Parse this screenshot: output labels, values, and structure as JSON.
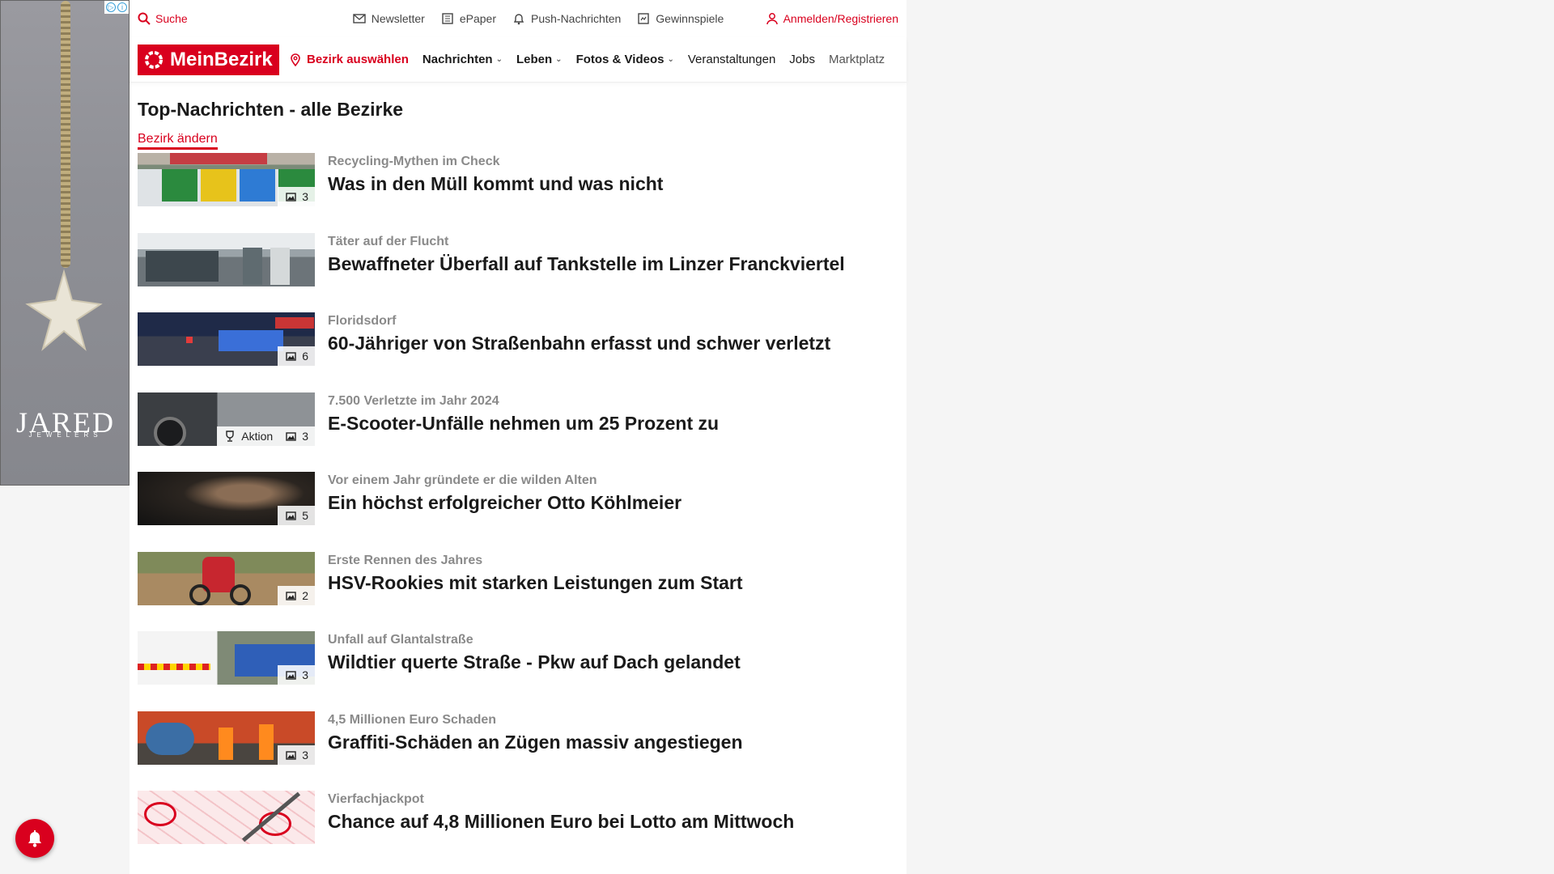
{
  "ad": {
    "brand": "JARED",
    "brand_sub": "JEWELERS"
  },
  "utility": {
    "search_label": "Suche",
    "links": [
      {
        "label": "Newsletter",
        "icon": "mail-icon"
      },
      {
        "label": "ePaper",
        "icon": "newspaper-icon"
      },
      {
        "label": "Push-Nachrichten",
        "icon": "bell-icon"
      },
      {
        "label": "Gewinnspiele",
        "icon": "gift-icon"
      }
    ],
    "login_label": "Anmelden/Registrieren"
  },
  "nav": {
    "logo_text": "MeinBezirk",
    "district_label": "Bezirk auswählen",
    "items": [
      {
        "label": "Nachrichten",
        "has_dropdown": true
      },
      {
        "label": "Leben",
        "has_dropdown": true
      },
      {
        "label": "Fotos & Videos",
        "has_dropdown": true
      },
      {
        "label": "Veranstaltungen",
        "has_dropdown": false
      },
      {
        "label": "Jobs",
        "has_dropdown": false
      },
      {
        "label": "Marktplatz",
        "has_dropdown": false
      }
    ]
  },
  "section": {
    "title": "Top-Nachrichten - alle Bezirke",
    "change_label": "Bezirk ändern"
  },
  "articles": [
    {
      "kicker": "Recycling-Mythen im Check",
      "headline": "Was in den Müll kommt und was nicht",
      "photos": "3",
      "badge": ""
    },
    {
      "kicker": "Täter auf der Flucht",
      "headline": "Bewaffneter Überfall auf Tankstelle im Linzer Franckviertel",
      "photos": "",
      "badge": ""
    },
    {
      "kicker": "Floridsdorf",
      "headline": "60-Jähriger von Straßenbahn erfasst und schwer verletzt",
      "photos": "6",
      "badge": ""
    },
    {
      "kicker": "7.500 Verletzte im Jahr 2024",
      "headline": "E-Scooter-Unfälle nehmen um 25 Prozent zu",
      "photos": "3",
      "badge": "Aktion"
    },
    {
      "kicker": "Vor einem Jahr gründete er die wilden Alten",
      "headline": "Ein höchst erfolgreicher Otto Köhlmeier",
      "photos": "5",
      "badge": ""
    },
    {
      "kicker": "Erste Rennen des Jahres",
      "headline": "HSV-Rookies mit starken Leistungen zum Start",
      "photos": "2",
      "badge": ""
    },
    {
      "kicker": "Unfall auf Glantalstraße",
      "headline": "Wildtier querte Straße - Pkw auf Dach gelandet",
      "photos": "3",
      "badge": ""
    },
    {
      "kicker": "4,5 Millionen Euro Schaden",
      "headline": "Graffiti-Schäden an Zügen massiv angestiegen",
      "photos": "3",
      "badge": ""
    },
    {
      "kicker": "Vierfachjackpot",
      "headline": "Chance auf 4,8 Millionen Euro bei Lotto am Mittwoch",
      "photos": "",
      "badge": ""
    }
  ],
  "colors": {
    "brand_red": "#d9001e",
    "kicker_gray": "#8a8a8a"
  }
}
